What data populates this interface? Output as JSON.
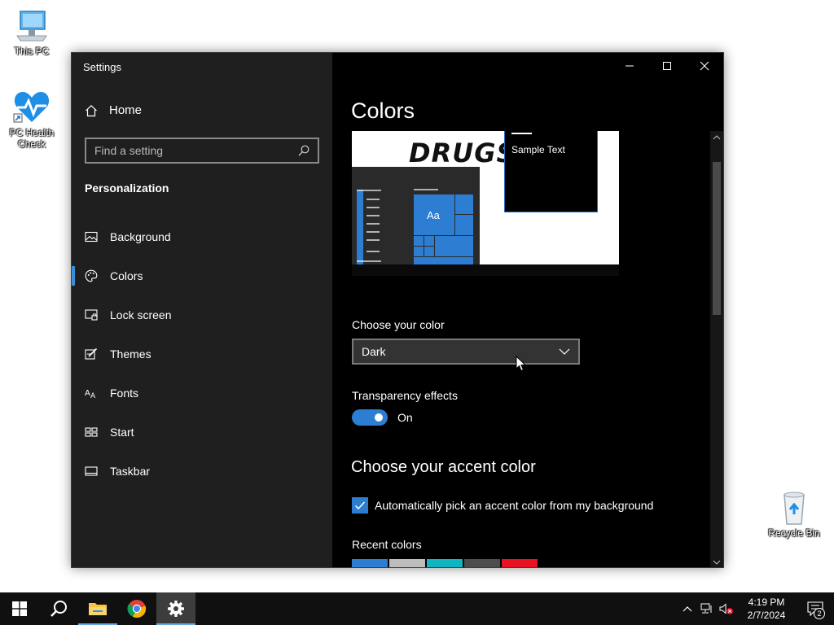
{
  "desktop": {
    "icons": [
      {
        "label": "This PC",
        "icon": "computer-icon"
      },
      {
        "label": "PC Health Check",
        "icon": "heart-pulse-icon"
      },
      {
        "label": "Recycle Bin",
        "icon": "recycle-bin-icon"
      }
    ]
  },
  "window": {
    "title": "Settings",
    "home_label": "Home",
    "search_placeholder": "Find a setting",
    "section": "Personalization",
    "nav": [
      {
        "label": "Background",
        "icon": "image-icon",
        "selected": false
      },
      {
        "label": "Colors",
        "icon": "palette-icon",
        "selected": true
      },
      {
        "label": "Lock screen",
        "icon": "lock-screen-icon",
        "selected": false
      },
      {
        "label": "Themes",
        "icon": "themes-brush-icon",
        "selected": false
      },
      {
        "label": "Fonts",
        "icon": "fonts-icon",
        "selected": false
      },
      {
        "label": "Start",
        "icon": "start-grid-icon",
        "selected": false
      },
      {
        "label": "Taskbar",
        "icon": "taskbar-icon",
        "selected": false
      }
    ]
  },
  "content": {
    "title": "Colors",
    "preview": {
      "wallpaper_text": "DRUGS",
      "tile_label": "Aa",
      "sample_text": "Sample Text"
    },
    "choose_color_label": "Choose your color",
    "choose_color_value": "Dark",
    "transparency_label": "Transparency effects",
    "transparency_state": "On",
    "accent_heading": "Choose your accent color",
    "auto_accent_label": "Automatically pick an accent color from my background",
    "auto_accent_checked": true,
    "recent_colors_label": "Recent colors",
    "recent_colors": [
      "#2d7dd2",
      "#bdbdbd",
      "#0fb5c0",
      "#4d4d4d",
      "#e81123"
    ],
    "accent_color": "#2d7dd2"
  },
  "taskbar": {
    "apps": [
      {
        "name": "Start",
        "icon": "windows-logo-icon"
      },
      {
        "name": "Search",
        "icon": "search-icon"
      },
      {
        "name": "File Explorer",
        "icon": "folder-icon"
      },
      {
        "name": "Google Chrome",
        "icon": "chrome-icon"
      },
      {
        "name": "Settings",
        "icon": "gear-icon",
        "active": true
      }
    ],
    "time": "4:19 PM",
    "date": "2/7/2024",
    "notification_count": "2"
  }
}
